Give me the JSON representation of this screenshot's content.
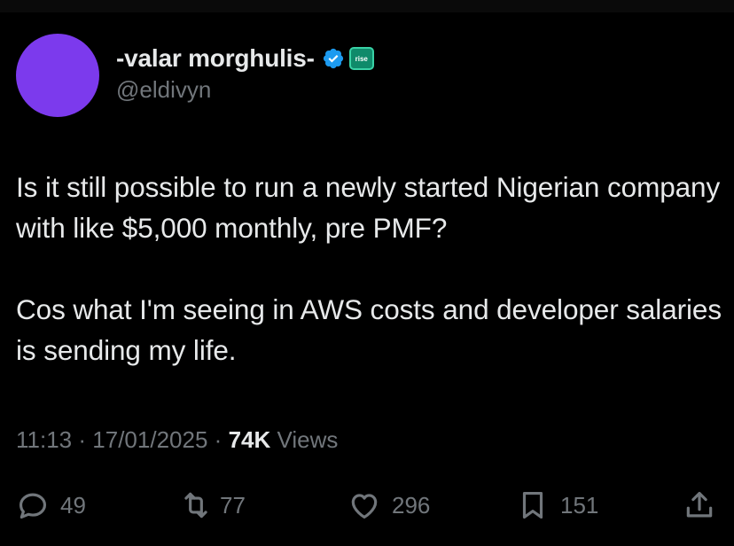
{
  "author": {
    "display_name": "-valar morghulis-",
    "handle": "@eldivyn",
    "affiliate_badge_text": "rise",
    "avatar_color": "#7c3aed",
    "verified_color": "#1d9bf0"
  },
  "tweet": {
    "paragraphs": [
      "Is it still possible to run a newly started Nigerian company with like $5,000 monthly, pre PMF?",
      "Cos what I'm seeing in AWS costs and developer salaries is sending my life."
    ],
    "time": "11:13",
    "date": "17/01/2025",
    "separator": "·",
    "views_count": "74K",
    "views_label": "Views"
  },
  "actions": {
    "reply_icon": "reply-icon",
    "reply_count": "49",
    "retweet_icon": "retweet-icon",
    "retweet_count": "77",
    "like_icon": "heart-icon",
    "like_count": "296",
    "bookmark_icon": "bookmark-icon",
    "bookmark_count": "151",
    "share_icon": "share-icon"
  }
}
